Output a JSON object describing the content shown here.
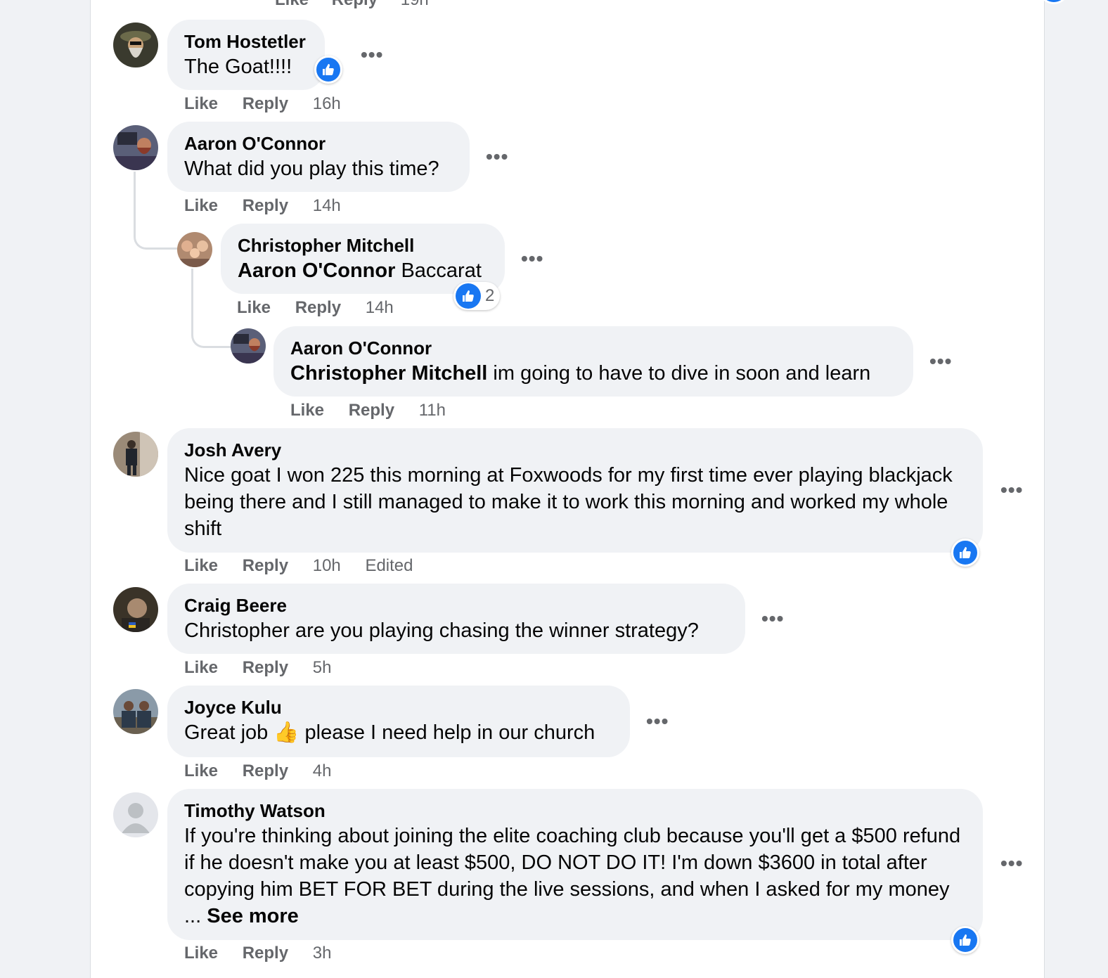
{
  "top_partial": {
    "like": "Like",
    "reply": "Reply",
    "time": "19h"
  },
  "comments": [
    {
      "author": "Tom Hostetler",
      "text": "The Goat!!!!",
      "like": "Like",
      "reply": "Reply",
      "time": "16h"
    },
    {
      "author": "Aaron O'Connor",
      "text": "What did you play this time?",
      "like": "Like",
      "reply": "Reply",
      "time": "14h"
    },
    {
      "author": "Christopher Mitchell",
      "tag": "Aaron O'Connor",
      "text": " Baccarat",
      "reaction_count": "2",
      "like": "Like",
      "reply": "Reply",
      "time": "14h"
    },
    {
      "author": "Aaron O'Connor",
      "tag": "Christopher Mitchell",
      "text": " im going to have to dive in soon and learn",
      "like": "Like",
      "reply": "Reply",
      "time": "11h"
    },
    {
      "author": "Josh Avery",
      "text": "Nice goat I won 225 this morning at Foxwoods for my first time ever playing blackjack being there and I still managed to make it to work this morning and worked my whole shift",
      "like": "Like",
      "reply": "Reply",
      "time": "10h",
      "edited": "Edited"
    },
    {
      "author": "Craig Beere",
      "text": "Christopher are you playing chasing the winner strategy?",
      "like": "Like",
      "reply": "Reply",
      "time": "5h"
    },
    {
      "author": "Joyce Kulu",
      "text_before": "Great job ",
      "emoji": "👍",
      "text_after": " please I need help in our church",
      "like": "Like",
      "reply": "Reply",
      "time": "4h"
    },
    {
      "author": "Timothy Watson",
      "text": "If you're thinking about joining the elite coaching club because you'll get a $500 refund if he doesn't make you at least $500, DO NOT DO IT! I'm down $3600 in total after copying him BET FOR BET during the live sessions, and when I asked for my money ... ",
      "see_more": "See more",
      "like": "Like",
      "reply": "Reply",
      "time": "3h"
    }
  ],
  "more_options": "•••",
  "colors": {
    "bubble": "#f0f2f5",
    "like_blue": "#1877f2",
    "meta_gray": "#65676b",
    "page_bg": "#f0f2f5"
  }
}
